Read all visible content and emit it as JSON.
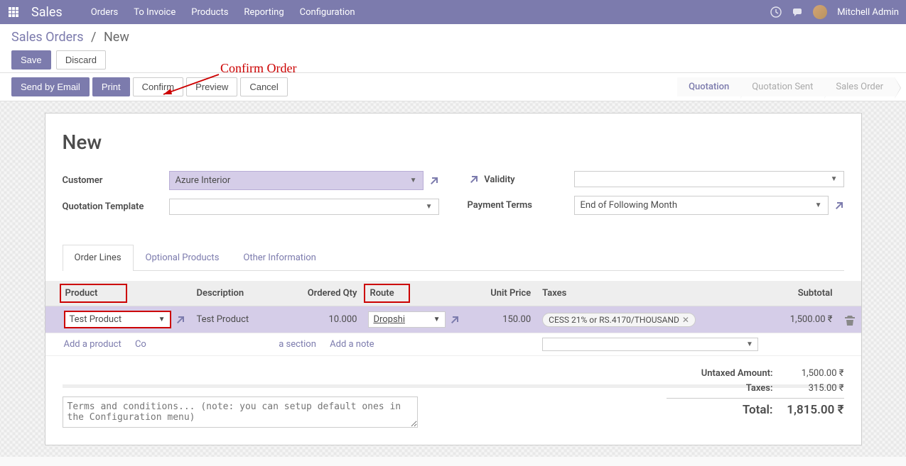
{
  "topbar": {
    "app_title": "Sales",
    "menu": [
      "Orders",
      "To Invoice",
      "Products",
      "Reporting",
      "Configuration"
    ],
    "user_name": "Mitchell Admin"
  },
  "breadcrumb": {
    "root": "Sales Orders",
    "current": "New"
  },
  "buttons": {
    "save": "Save",
    "discard": "Discard",
    "send_email": "Send by Email",
    "print": "Print",
    "confirm": "Confirm",
    "preview": "Preview",
    "cancel": "Cancel"
  },
  "annotation": "Confirm  Order",
  "status": {
    "quotation": "Quotation",
    "quotation_sent": "Quotation Sent",
    "sales_order": "Sales Order"
  },
  "sheet": {
    "title": "New",
    "labels": {
      "customer": "Customer",
      "quotation_template": "Quotation Template",
      "validity": "Validity",
      "payment_terms": "Payment Terms"
    },
    "customer": "Azure Interior",
    "quotation_template": "",
    "validity": "",
    "payment_terms": "End of Following Month"
  },
  "tabs": {
    "order_lines": "Order Lines",
    "optional_products": "Optional Products",
    "other_info": "Other Information"
  },
  "table": {
    "headers": {
      "product": "Product",
      "description": "Description",
      "ordered_qty": "Ordered Qty",
      "route": "Route",
      "unit_price": "Unit Price",
      "taxes": "Taxes",
      "subtotal": "Subtotal"
    },
    "row": {
      "product": "Test Product",
      "description": "Test Product",
      "qty": "10.000",
      "route": "Dropshi",
      "unit_price": "150.00",
      "tax": "CESS 21% or RS.4170/THOUSAND",
      "subtotal": "1,500.00 ₹"
    },
    "add_product": "Add a product",
    "add_section_prefix": "Co",
    "add_section_suffix": "a section",
    "add_note": "Add a note"
  },
  "terms_placeholder": "Terms and conditions... (note: you can setup default ones in the Configuration menu)",
  "totals": {
    "untaxed_label": "Untaxed Amount:",
    "untaxed": "1,500.00 ₹",
    "taxes_label": "Taxes:",
    "taxes": "315.00 ₹",
    "total_label": "Total:",
    "total": "1,815.00 ₹"
  }
}
